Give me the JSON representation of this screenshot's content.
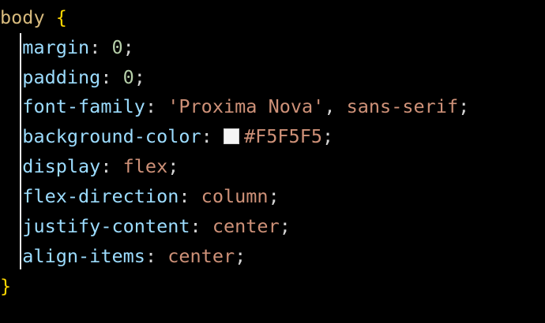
{
  "code": {
    "selector": "body",
    "open_brace": "{",
    "close_brace": "}",
    "declarations": [
      {
        "property": "margin",
        "value": "0",
        "kind": "num"
      },
      {
        "property": "padding",
        "value": "0",
        "kind": "num"
      },
      {
        "property": "font-family",
        "value_string": "'Proxima Nova'",
        "value_rest": "sans-serif",
        "kind": "font"
      },
      {
        "property": "background-color",
        "value": "#F5F5F5",
        "kind": "color"
      },
      {
        "property": "display",
        "value": "flex",
        "kind": "val"
      },
      {
        "property": "flex-direction",
        "value": "column",
        "kind": "val"
      },
      {
        "property": "justify-content",
        "value": "center",
        "kind": "val"
      },
      {
        "property": "align-items",
        "value": "center",
        "kind": "val"
      }
    ]
  },
  "colors": {
    "background": "#000000",
    "selector": "#d7ba7d",
    "brace": "#ffd700",
    "property": "#9cdcfe",
    "number": "#b5cea8",
    "string": "#ce9178",
    "swatch": "#F5F5F5"
  }
}
